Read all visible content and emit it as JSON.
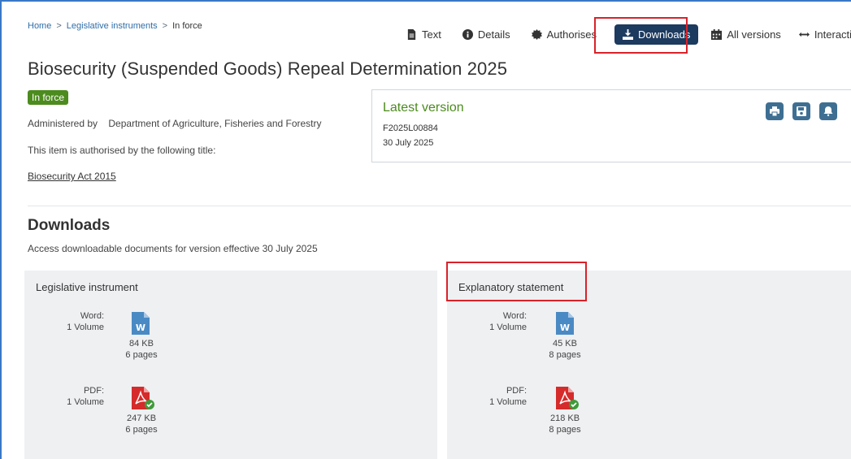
{
  "breadcrumb": {
    "home": "Home",
    "sep": ">",
    "section": "Legislative instruments",
    "current": "In force"
  },
  "toolbar": {
    "text": "Text",
    "details": "Details",
    "authorises": "Authorises",
    "downloads": "Downloads",
    "all_versions": "All versions",
    "interactions": "Interactions"
  },
  "title": "Biosecurity (Suspended Goods) Repeal Determination 2025",
  "status": "In force",
  "administered_label": "Administered by",
  "administered_value": "Department of Agriculture, Fisheries and Forestry",
  "authorised_text": "This item is authorised by the following title:",
  "authorised_link": "Biosecurity Act 2015",
  "latest": {
    "title": "Latest version",
    "id": "F2025L00884",
    "date": "30 July 2025"
  },
  "downloads": {
    "title": "Downloads",
    "subtitle": "Access downloadable documents for version effective 30 July 2025",
    "cards": [
      {
        "title": "Legislative instrument",
        "word": {
          "label": "Word:",
          "volume": "1 Volume",
          "size": "84 KB",
          "pages": "6 pages"
        },
        "pdf": {
          "label": "PDF:",
          "volume": "1 Volume",
          "size": "247 KB",
          "pages": "6 pages"
        }
      },
      {
        "title": "Explanatory statement",
        "word": {
          "label": "Word:",
          "volume": "1 Volume",
          "size": "45 KB",
          "pages": "8 pages"
        },
        "pdf": {
          "label": "PDF:",
          "volume": "1 Volume",
          "size": "218 KB",
          "pages": "8 pages"
        }
      }
    ]
  },
  "colors": {
    "accent_green": "#4c8b1e",
    "active_tab": "#1d3a5f",
    "highlight_red": "#d9222a",
    "icon_button": "#3e6f92",
    "word_blue": "#4a8ac4",
    "pdf_red": "#d52b2b"
  },
  "icons": {
    "text": "document-icon",
    "details": "info-icon",
    "authorises": "seal-icon",
    "downloads": "download-icon",
    "all_versions": "calendar-icon",
    "interactions": "arrows-icon",
    "print": "print-icon",
    "save": "save-icon",
    "notify": "bell-icon",
    "word": "word-file-icon",
    "pdf": "pdf-file-icon"
  }
}
